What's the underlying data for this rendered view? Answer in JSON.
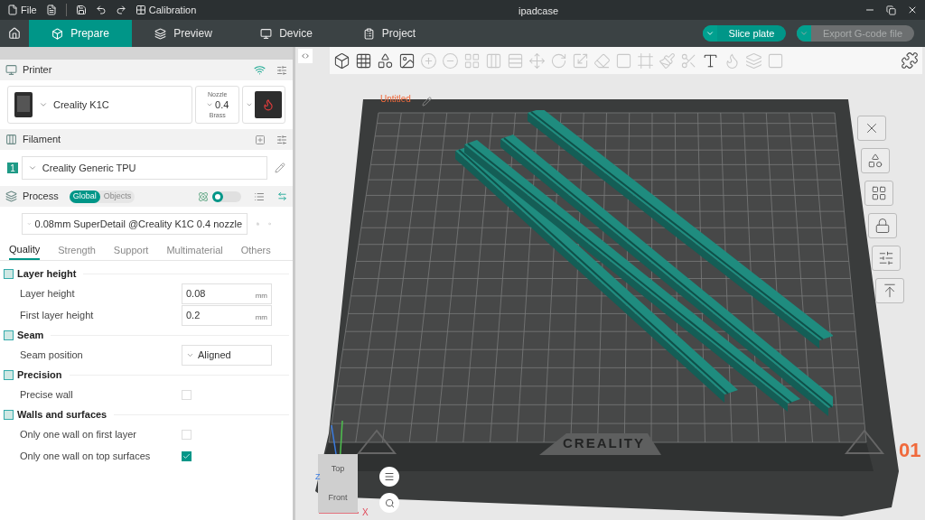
{
  "title_bar": {
    "file_menu": "File",
    "calibration": "Calibration",
    "title": "ipadcase"
  },
  "tabs": [
    {
      "label": "Prepare",
      "selected": true
    },
    {
      "label": "Preview",
      "selected": false
    },
    {
      "label": "Device",
      "selected": false
    },
    {
      "label": "Project",
      "selected": false
    }
  ],
  "actions": [
    {
      "label": "Slice plate",
      "disabled": false
    },
    {
      "label": "Export G-code file",
      "disabled": true
    }
  ],
  "printer": {
    "header": "Printer",
    "name": "Creality K1C",
    "nozzle_label": "Nozzle",
    "nozzle": "0.4",
    "nozzle_material": "Brass"
  },
  "filament": {
    "header": "Filament",
    "index": "1",
    "name": "Creality Generic TPU",
    "color": "#1f9a86"
  },
  "process": {
    "header": "Process",
    "modes": [
      {
        "label": "Global",
        "selected": true
      },
      {
        "label": "Objects",
        "selected": false
      }
    ],
    "advanced": false,
    "preset": "0.08mm SuperDetail @Creality K1C 0.4 nozzle",
    "tabs": [
      {
        "label": "Quality",
        "selected": true
      },
      {
        "label": "Strength",
        "selected": false
      },
      {
        "label": "Support",
        "selected": false
      },
      {
        "label": "Multimaterial",
        "selected": false
      },
      {
        "label": "Others",
        "selected": false
      }
    ]
  },
  "settings": [
    {
      "title": "Layer height",
      "items": [
        {
          "kind": "number",
          "label": "Layer height",
          "value": "0.08",
          "unit": "mm"
        },
        {
          "kind": "number",
          "label": "First layer height",
          "value": "0.2",
          "unit": "mm"
        }
      ]
    },
    {
      "title": "Seam",
      "items": [
        {
          "kind": "select",
          "label": "Seam position",
          "value": "Aligned"
        }
      ]
    },
    {
      "title": "Precision",
      "items": [
        {
          "kind": "checkbox",
          "label": "Precise wall",
          "checked": false
        }
      ]
    },
    {
      "title": "Walls and surfaces",
      "items": [
        {
          "kind": "checkbox",
          "label": "Only one wall on first layer",
          "checked": false
        },
        {
          "kind": "checkbox",
          "label": "Only one wall on top surfaces",
          "checked": true
        }
      ]
    }
  ],
  "viewport": {
    "plate_name": "Untitled",
    "plate_number": "01",
    "bed_brand": "CREALITY",
    "view_top": "Top",
    "view_front": "Front",
    "axis_z": "Z",
    "axis_x": "X"
  }
}
